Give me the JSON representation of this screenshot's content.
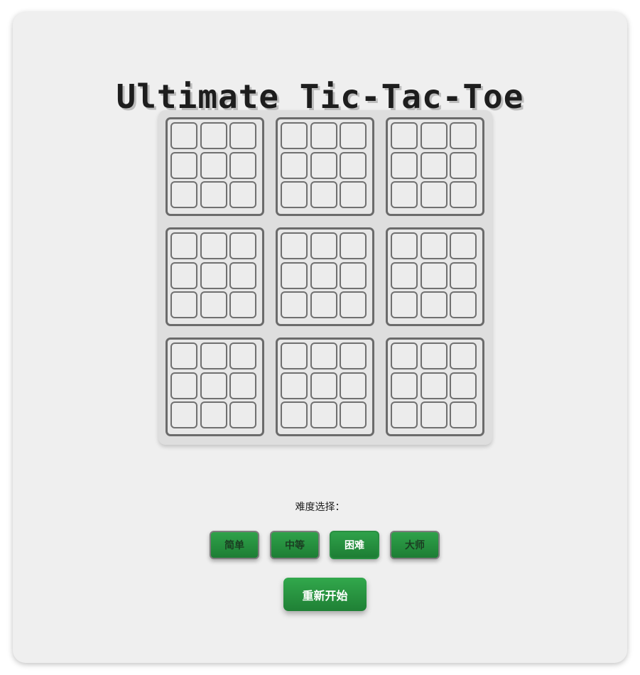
{
  "title": "Ultimate Tic-Tac-Toe",
  "board": {
    "size": 3,
    "mini_size": 3,
    "cells": [
      [
        "",
        "",
        "",
        "",
        "",
        "",
        "",
        "",
        ""
      ],
      [
        "",
        "",
        "",
        "",
        "",
        "",
        "",
        "",
        ""
      ],
      [
        "",
        "",
        "",
        "",
        "",
        "",
        "",
        "",
        ""
      ],
      [
        "",
        "",
        "",
        "",
        "",
        "",
        "",
        "",
        ""
      ],
      [
        "",
        "",
        "",
        "",
        "",
        "",
        "",
        "",
        ""
      ],
      [
        "",
        "",
        "",
        "",
        "",
        "",
        "",
        "",
        ""
      ],
      [
        "",
        "",
        "",
        "",
        "",
        "",
        "",
        "",
        ""
      ],
      [
        "",
        "",
        "",
        "",
        "",
        "",
        "",
        "",
        ""
      ],
      [
        "",
        "",
        "",
        "",
        "",
        "",
        "",
        "",
        ""
      ]
    ]
  },
  "difficulty": {
    "label": "难度选择：",
    "options": [
      "简单",
      "中等",
      "困难",
      "大师"
    ],
    "selected": "困难"
  },
  "restart_label": "重新开始",
  "colors": {
    "button_green": "#2a9a45",
    "board_bg": "#dedede",
    "grid_border": "#6b6b6b"
  }
}
